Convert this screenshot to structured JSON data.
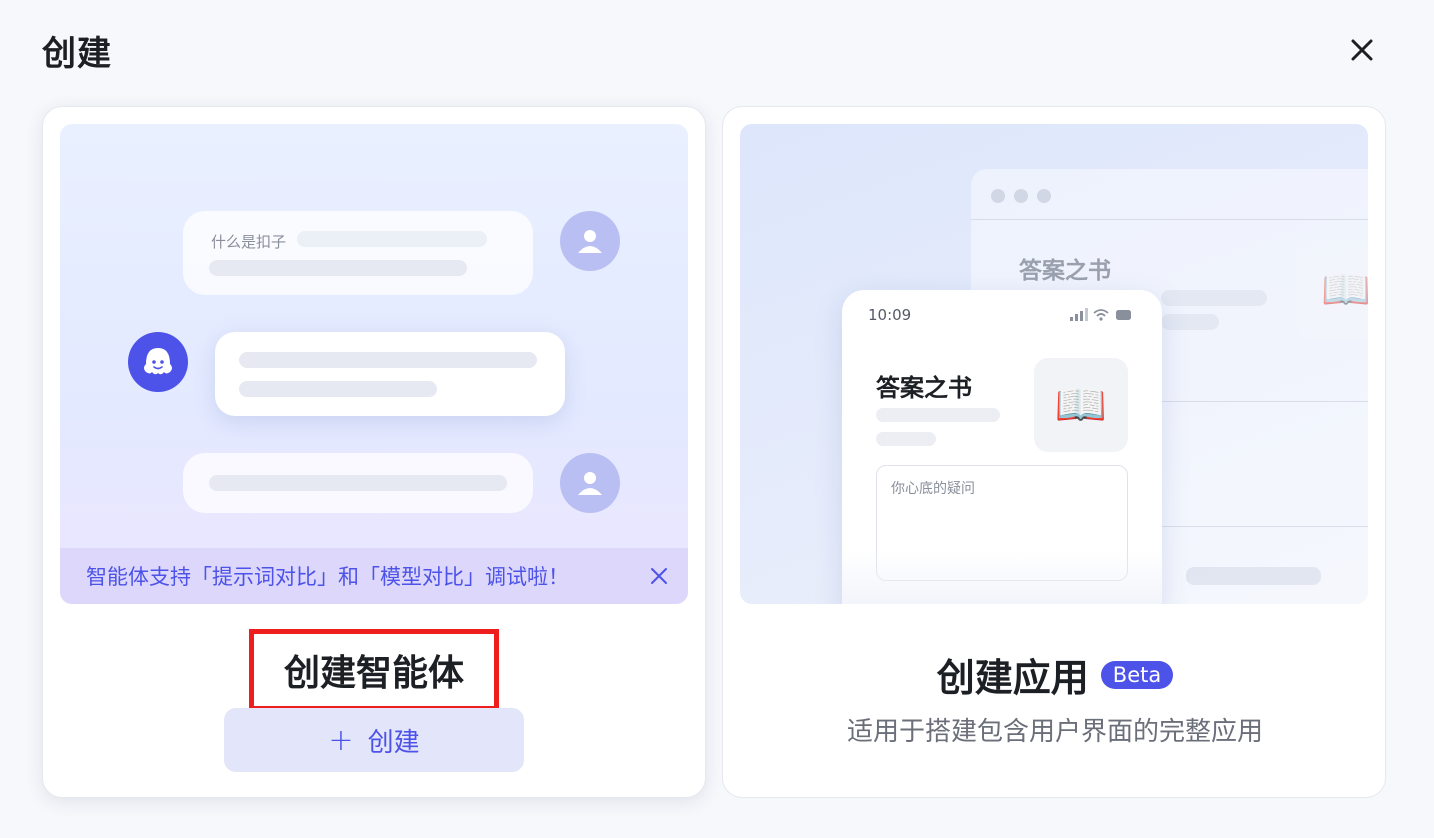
{
  "dialog": {
    "title": "创建"
  },
  "agent_card": {
    "preview": {
      "user_question": "什么是扣子",
      "notice": "智能体支持「提示词对比」和「模型对比」调试啦！"
    },
    "title": "创建智能体",
    "create_button": {
      "icon": "+",
      "label": "创建"
    }
  },
  "app_card": {
    "preview": {
      "background_title": "答案之书",
      "phone_time": "10:09",
      "phone_title": "答案之书",
      "book_icon": "📖",
      "input_placeholder": "你心底的疑问"
    },
    "title": "创建应用",
    "badge": "Beta",
    "subtitle": "适用于搭建包含用户界面的完整应用"
  },
  "colors": {
    "accent": "#4d53e8",
    "highlight_border": "#ee1e1e",
    "notice_bg": "#dcd7fb"
  }
}
